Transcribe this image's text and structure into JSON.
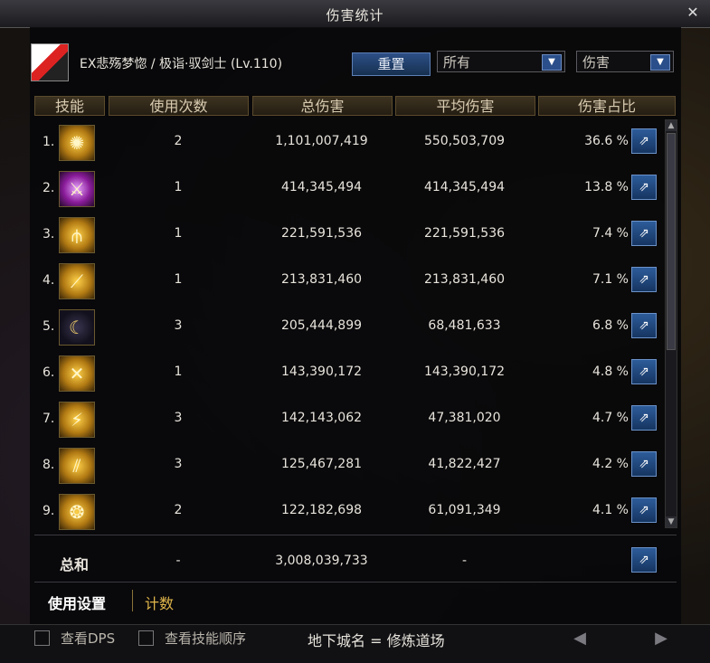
{
  "window": {
    "title": "伤害统计"
  },
  "header": {
    "character": "EX悲殇梦惚 / 极诣·驭剑士 (Lv.110)",
    "reset_label": "重置",
    "filter1": "所有",
    "filter2": "伤害"
  },
  "columns": [
    "技能",
    "使用次数",
    "总伤害",
    "平均伤害",
    "伤害占比"
  ],
  "rows": [
    {
      "rank": "1.",
      "uses": "2",
      "total": "1,101,007,419",
      "avg": "550,503,709",
      "pct": "36.6 %"
    },
    {
      "rank": "2.",
      "uses": "1",
      "total": "414,345,494",
      "avg": "414,345,494",
      "pct": "13.8 %"
    },
    {
      "rank": "3.",
      "uses": "1",
      "total": "221,591,536",
      "avg": "221,591,536",
      "pct": "7.4 %"
    },
    {
      "rank": "4.",
      "uses": "1",
      "total": "213,831,460",
      "avg": "213,831,460",
      "pct": "7.1 %"
    },
    {
      "rank": "5.",
      "uses": "3",
      "total": "205,444,899",
      "avg": "68,481,633",
      "pct": "6.8 %"
    },
    {
      "rank": "6.",
      "uses": "1",
      "total": "143,390,172",
      "avg": "143,390,172",
      "pct": "4.8 %"
    },
    {
      "rank": "7.",
      "uses": "3",
      "total": "142,143,062",
      "avg": "47,381,020",
      "pct": "4.7 %"
    },
    {
      "rank": "8.",
      "uses": "3",
      "total": "125,467,281",
      "avg": "41,822,427",
      "pct": "4.2 %"
    },
    {
      "rank": "9.",
      "uses": "2",
      "total": "122,182,698",
      "avg": "61,091,349",
      "pct": "4.1 %"
    }
  ],
  "summary": {
    "label": "总和",
    "uses": "-",
    "total": "3,008,039,733",
    "avg": "-"
  },
  "tabs": {
    "settings": "使用设置",
    "count": "计数"
  },
  "footer": {
    "check_dps": "查看DPS",
    "check_order": "查看技能顺序",
    "dungeon": "地下城名 = 修炼道场"
  },
  "colors": {
    "accent": "#e0b64a",
    "button": "#2a4f8a"
  }
}
